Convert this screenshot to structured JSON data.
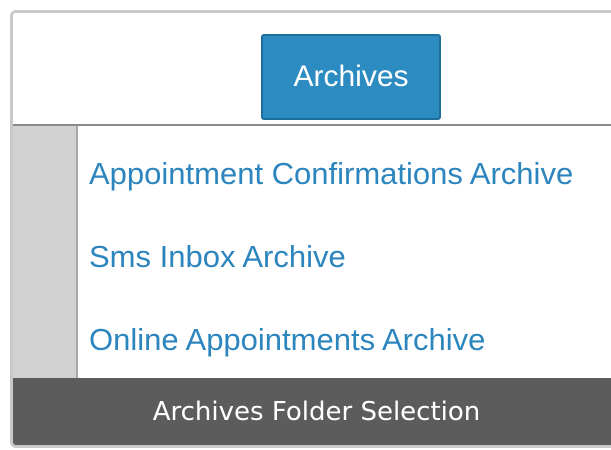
{
  "header": {
    "tab_label": "Archives"
  },
  "archives_list": {
    "items": [
      {
        "label": "Appointment Confirmations Archive"
      },
      {
        "label": "Sms Inbox Archive"
      },
      {
        "label": "Online Appointments Archive"
      }
    ]
  },
  "footer": {
    "title": "Archives Folder Selection"
  },
  "colors": {
    "accent": "#2c8bc0",
    "link": "#2d85be",
    "footer_bg": "#5c5c5c",
    "gutter_bg": "#d2d2d2"
  }
}
